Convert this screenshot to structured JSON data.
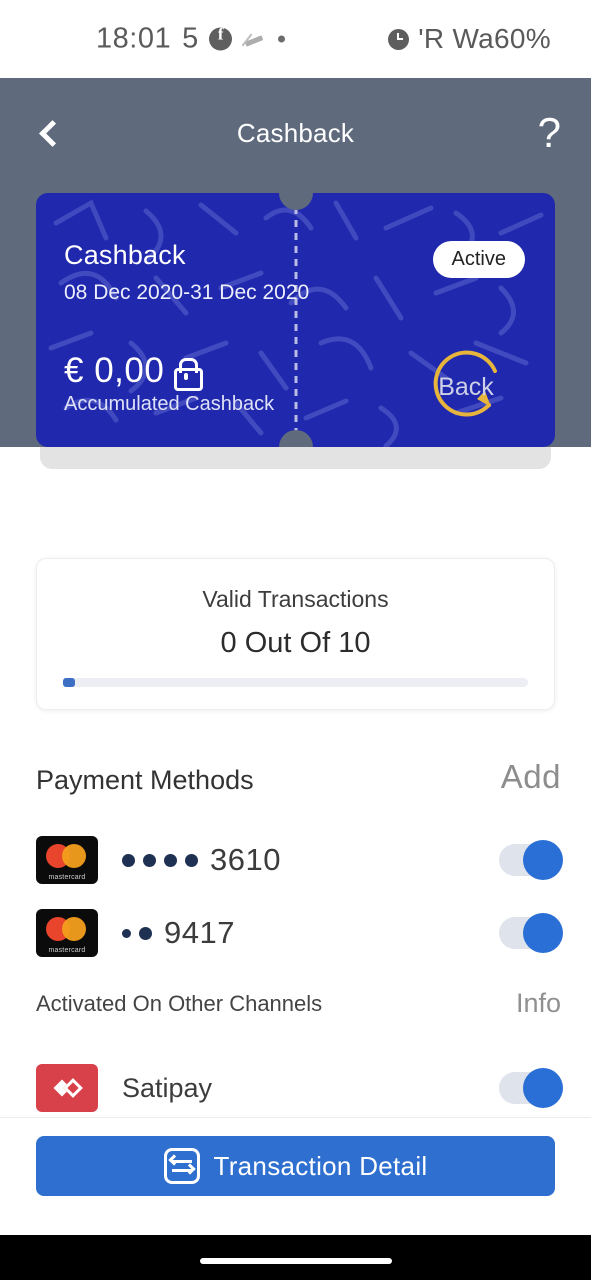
{
  "statusbar": {
    "time": "18:01",
    "notif_count": "5",
    "facebook_icon": "facebook-icon",
    "muted_icon": "notifications-muted-icon",
    "dot_icon": "dot-icon",
    "alarm_icon": "alarm-clock-icon",
    "battery": "'R Wa60%"
  },
  "header": {
    "back_icon": "chevron-left-icon",
    "title": "Cashback",
    "help_label": "?"
  },
  "card": {
    "title": "Cashback",
    "dates": "08 Dec 2020-31 Dec 2020",
    "status_badge": "Active",
    "amount": "€ 0,00",
    "lock_icon": "lock-icon",
    "amount_label": "Accumulated Cashback",
    "cashback_icon": "cashback-circular-arrow-icon",
    "cashback_icon_label": "Back",
    "bg_color": "#2028ad",
    "accent_gold": "#e8b53c"
  },
  "valid_transactions": {
    "title": "Valid Transactions",
    "count": "0 Out Of 10",
    "progress_percent": 0
  },
  "payment_methods": {
    "title": "Payment Methods",
    "add_label": "Add",
    "items": [
      {
        "logo": "mastercard-logo",
        "logo_text": "mastercard",
        "masked_dots": 4,
        "number": "3610",
        "toggle_on": true
      },
      {
        "logo": "mastercard-logo",
        "logo_text": "mastercard",
        "masked_dots": 2,
        "number": "9417",
        "toggle_on": true
      }
    ]
  },
  "other_channels": {
    "title": "Activated On Other Channels",
    "info_label": "Info",
    "items": [
      {
        "logo": "satispay-logo",
        "name": "Satipay",
        "toggle_on": true
      }
    ]
  },
  "cta": {
    "icon": "transaction-exchange-icon",
    "label": "Transaction Detail",
    "color": "#2f6fd0"
  },
  "navbar": {
    "home_indicator": "home-indicator"
  }
}
